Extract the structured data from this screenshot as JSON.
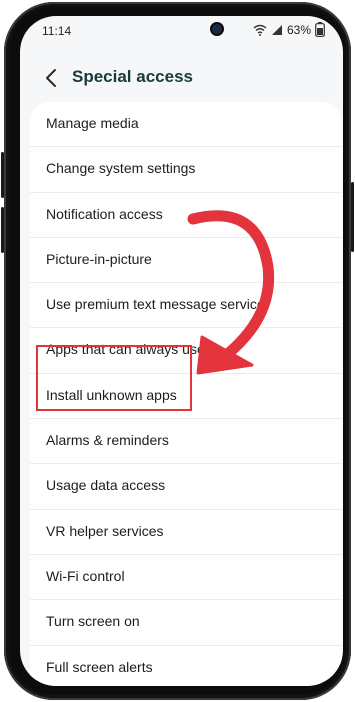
{
  "status_bar": {
    "time": "11:14",
    "battery": "63%",
    "icons": [
      "wifi-icon",
      "signal-icon",
      "battery-icon"
    ]
  },
  "header": {
    "back_icon": "chevron-left-icon",
    "title": "Special access"
  },
  "list": {
    "items": [
      {
        "label": "Manage media"
      },
      {
        "label": "Change system settings"
      },
      {
        "label": "Notification access"
      },
      {
        "label": "Picture-in-picture"
      },
      {
        "label": "Use premium text message service"
      },
      {
        "label": "Apps that can always use da"
      },
      {
        "label": "Install unknown apps"
      },
      {
        "label": "Alarms & reminders"
      },
      {
        "label": "Usage data access"
      },
      {
        "label": "VR helper services"
      },
      {
        "label": "Wi-Fi control"
      },
      {
        "label": "Turn screen on"
      },
      {
        "label": "Full screen alerts"
      }
    ],
    "highlighted_item": "Install unknown apps"
  },
  "colors": {
    "accent": "#173a3a",
    "annotation": "#e3333c",
    "screen_bg": "#f6f7f9",
    "card_bg": "#ffffff"
  }
}
